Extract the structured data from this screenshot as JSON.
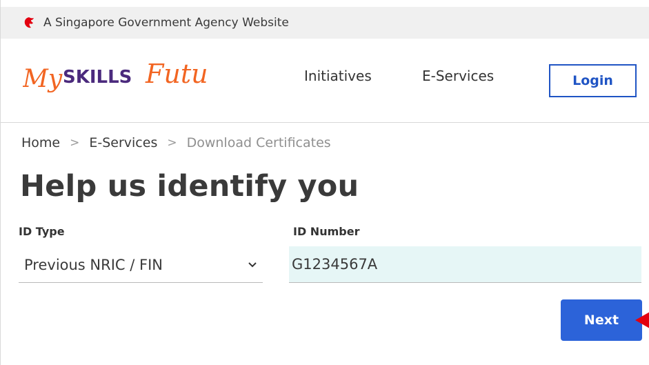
{
  "masthead": {
    "text": "A Singapore Government Agency Website",
    "icon": "singapore-lion-icon"
  },
  "header": {
    "logo": {
      "part1": "My",
      "part2": "SKILLS",
      "part3": "Futu",
      "colors": {
        "orange": "#f26522",
        "purple": "#4b2a7d"
      }
    },
    "nav": [
      {
        "label": "Initiatives"
      },
      {
        "label": "E-Services"
      }
    ],
    "login_label": "Login"
  },
  "breadcrumb": {
    "items": [
      "Home",
      "E-Services",
      "Download Certificates"
    ],
    "separator": ">"
  },
  "form": {
    "title": "Help us identify you",
    "id_type": {
      "label": "ID Type",
      "value": "Previous NRIC / FIN"
    },
    "id_number": {
      "label": "ID Number",
      "value": "G1234567A"
    },
    "next_label": "Next"
  },
  "colors": {
    "accent": "#2c63d9",
    "login_border": "#1f54c4",
    "input_bg": "#e6f6f6",
    "annotation_arrow": "#e3000f"
  }
}
